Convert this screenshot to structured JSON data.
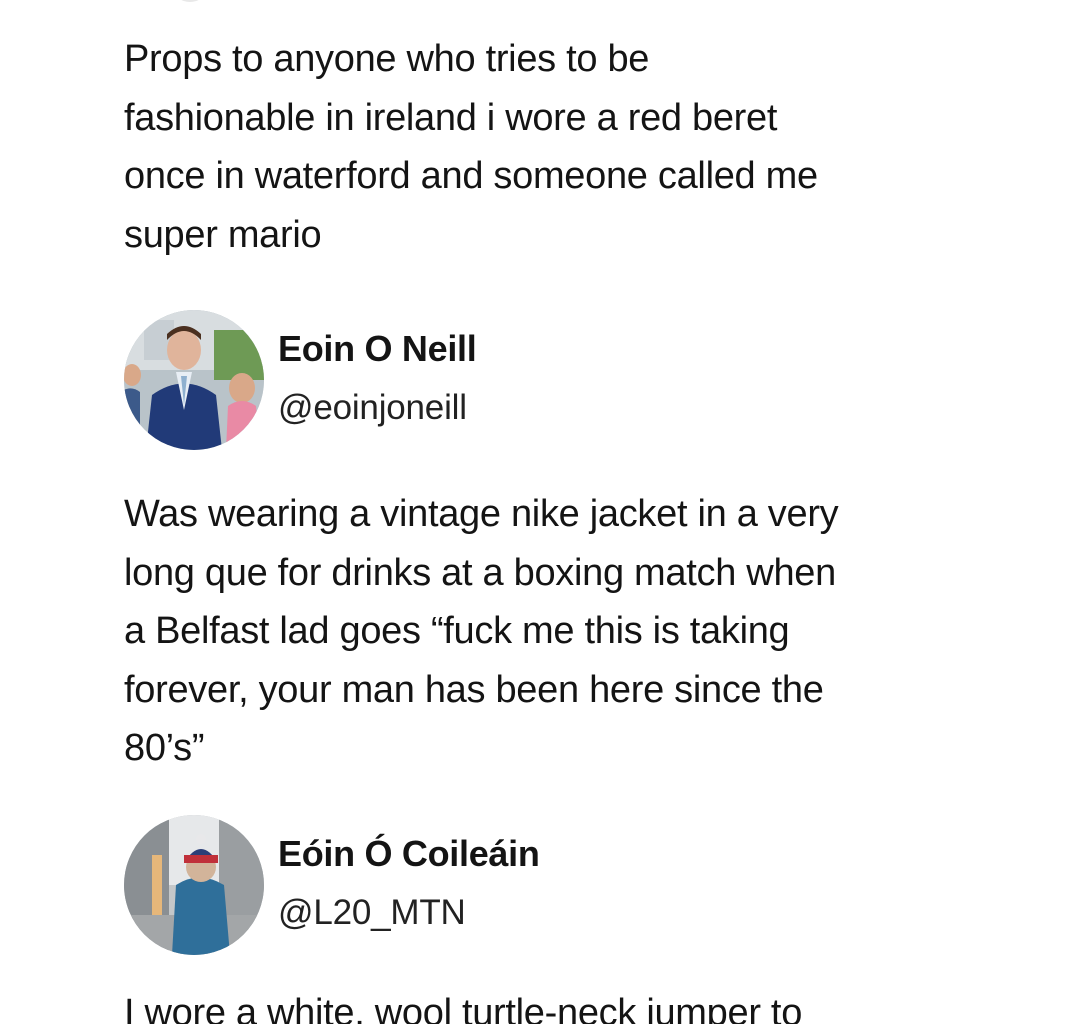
{
  "posts": [
    {
      "text": "Props to anyone who tries to be\nfashionable in ireland i wore a red beret\nonce in waterford and someone called me\nsuper mario"
    },
    {
      "author": {
        "name": "Eoin O Neill",
        "handle": "@eoinjoneill"
      },
      "text": "Was wearing a vintage nike jacket in a very\nlong que for drinks at a boxing match when\na Belfast lad goes “fuck me this is taking\nforever, your man has been here since the\n80’s”"
    },
    {
      "author": {
        "name": "Eóin Ó Coileáin",
        "handle": "@L20_MTN"
      },
      "text": "I wore a white, wool turtle-neck jumper to"
    }
  ]
}
